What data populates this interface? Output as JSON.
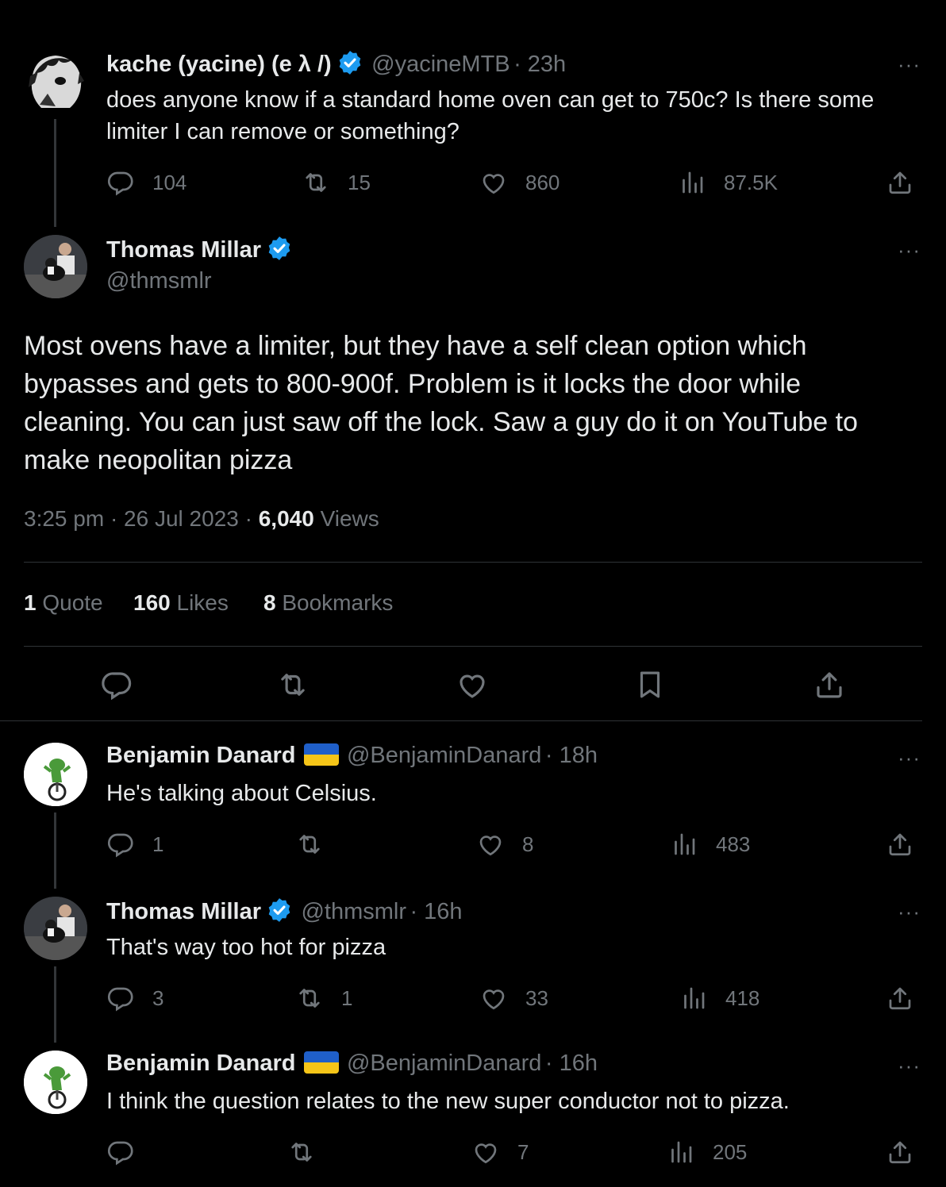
{
  "original_tweet": {
    "name": "kache (yacine) (e λ /)",
    "handle": "@yacineMTB",
    "time": "· 23h",
    "text_line1": "does anyone know if a standard home oven can get to 750c? Is there some",
    "text_line2": "limiter I can remove or something?",
    "replies": "104",
    "retweets": "15",
    "likes": "860",
    "views": "87.5K"
  },
  "main_tweet": {
    "name": "Thomas Millar",
    "handle": "@thmsmlr",
    "text_line1": "Most ovens have a limiter, but they have a self clean option which",
    "text_line2": "bypasses and gets to 800-900f. Problem is it locks the door while",
    "text_line3": "cleaning. You can just saw off the lock. Saw a guy do it on YouTube to",
    "text_line4": "make neopolitan pizza",
    "timestamp": "3:25 pm · 26 Jul 2023 · ",
    "views_count": "6,040",
    "views_label": " Views",
    "quote_count": "1",
    "quote_label": " Quote",
    "likes_count": "160",
    "likes_label": " Likes",
    "bookmarks_count": "8",
    "bookmarks_label": " Bookmarks"
  },
  "replies": [
    {
      "name": "Benjamin Danard",
      "handle": "@BenjaminDanard",
      "time": "· 18h",
      "text": "He's talking about Celsius.",
      "replies": "1",
      "retweets": "",
      "likes": "8",
      "views": "483"
    },
    {
      "name": "Thomas Millar",
      "handle": "@thmsmlr",
      "time": "· 16h",
      "text": "That's way too hot for pizza",
      "replies": "3",
      "retweets": "1",
      "likes": "33",
      "views": "418"
    },
    {
      "name": "Benjamin Danard",
      "handle": "@BenjaminDanard",
      "time": "· 16h",
      "text": "I think the question relates to the new super conductor not to pizza.",
      "replies": "",
      "retweets": "",
      "likes": "7",
      "views": "205"
    }
  ],
  "ui": {
    "more_glyph": "···"
  },
  "colors": {
    "background": "#000000",
    "text": "#e7e9ea",
    "muted": "#71767b",
    "verified": "#1d9bf0",
    "divider": "#2f3336"
  }
}
